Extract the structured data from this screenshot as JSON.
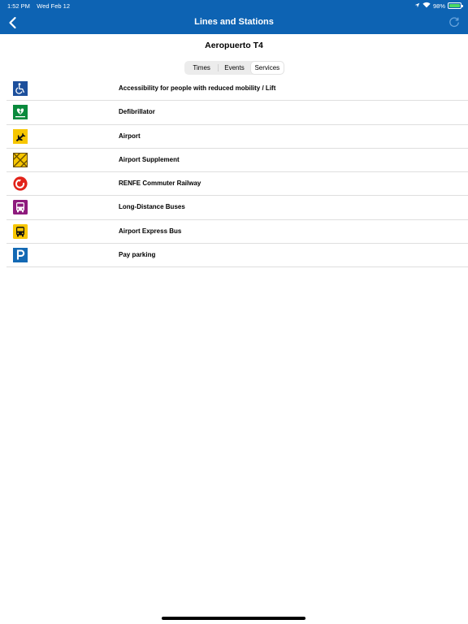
{
  "status_bar": {
    "time": "1:52 PM",
    "date": "Wed Feb 12",
    "battery": "98%",
    "battery_level": 0.98
  },
  "nav": {
    "title": "Lines and Stations",
    "back_icon": "chevron-left-icon",
    "refresh_icon": "refresh-icon"
  },
  "station": {
    "name": "Aeropuerto T4"
  },
  "tabs": [
    {
      "label": "Times",
      "selected": false
    },
    {
      "label": "Events",
      "selected": false
    },
    {
      "label": "Services",
      "selected": true
    }
  ],
  "services": [
    {
      "label": "Accessibility for people with reduced mobility / Lift",
      "icon": "wheelchair-icon"
    },
    {
      "label": "Defibrillator",
      "icon": "defibrillator-icon"
    },
    {
      "label": "Airport",
      "icon": "airplane-icon"
    },
    {
      "label": "Airport Supplement",
      "icon": "airport-supplement-icon"
    },
    {
      "label": "RENFE Commuter Railway",
      "icon": "renfe-icon"
    },
    {
      "label": "Long-Distance Buses",
      "icon": "long-distance-bus-icon"
    },
    {
      "label": "Airport Express Bus",
      "icon": "express-bus-icon"
    },
    {
      "label": "Pay parking",
      "icon": "parking-icon"
    }
  ],
  "colors": {
    "header": "#0d63b3",
    "accessibility": "#1c4f9c",
    "defibrillator": "#0a8a3c",
    "airport": "#f7c600",
    "renfe": "#e2231a",
    "long_distance_bus": "#8e1b7d",
    "express_bus": "#f7c600",
    "parking": "#1369b4"
  }
}
